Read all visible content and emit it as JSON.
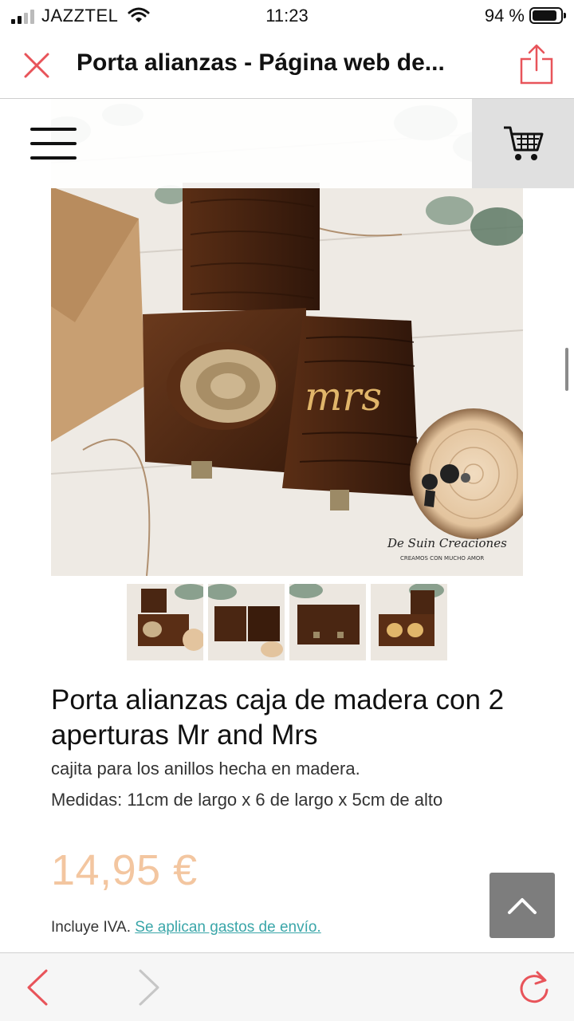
{
  "status_bar": {
    "carrier": "JAZZTEL",
    "time": "11:23",
    "battery": "94 %",
    "battery_level": 0.94
  },
  "browser": {
    "title": "Porta alianzas - Página web de..."
  },
  "product": {
    "title": "Porta alianzas caja de madera con 2 aperturas Mr and Mrs",
    "description_line1": "cajita para los anillos hecha en madera.",
    "description_line2": "Medidas: 11cm de largo x 6 de largo x 5cm de alto",
    "price": "14,95 €",
    "tax_text": "Incluye IVA.",
    "shipping_link": "Se aplican gastos de envío.",
    "image_engraving": "mrs",
    "watermark_brand": "De Suin Creaciones",
    "watermark_tagline": "CREAMOS CON MUCHO AMOR",
    "thumbnail_count": 4
  },
  "colors": {
    "accent_red": "#e8545a",
    "price_color": "#f3c6a0",
    "link_color": "#3aa6a9",
    "wood_dark": "#4a2612"
  },
  "icons": {
    "close": "close-icon",
    "share": "share-icon",
    "menu": "hamburger-menu-icon",
    "cart": "cart-icon",
    "scroll_top": "chevron-up-icon",
    "back": "chevron-left-icon",
    "forward": "chevron-right-icon",
    "reload": "reload-icon"
  }
}
